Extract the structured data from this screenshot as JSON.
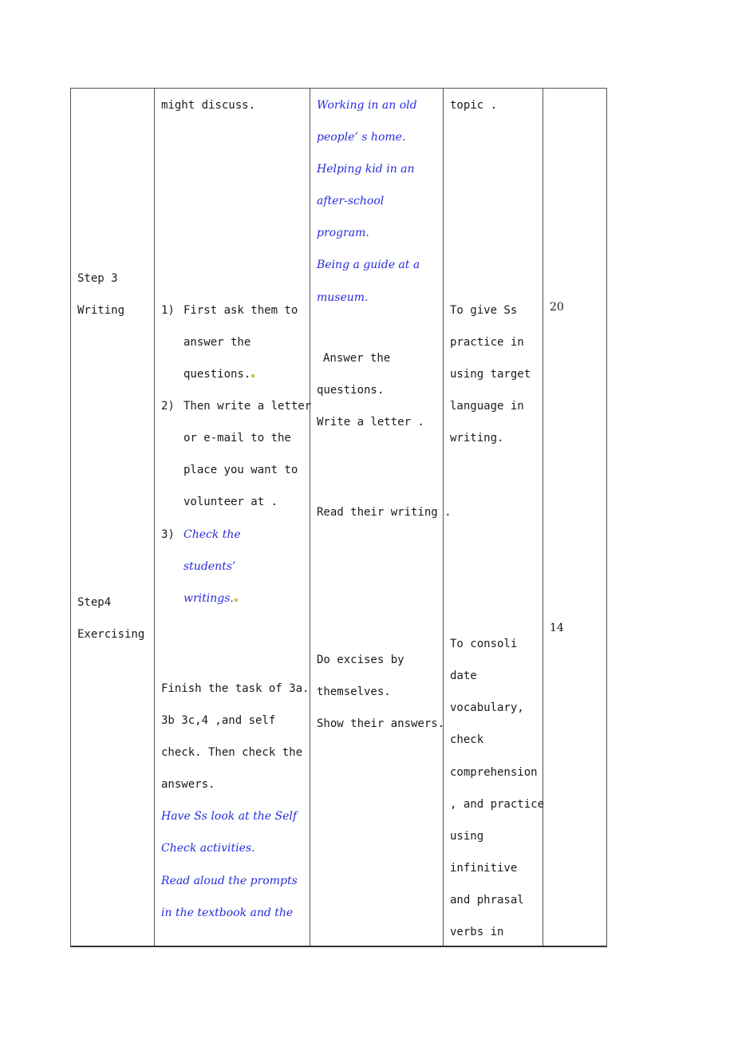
{
  "table": {
    "step_column": [
      {
        "id": "step3",
        "lines": [
          "Step 3",
          "Writing"
        ]
      },
      {
        "id": "step4",
        "lines": [
          "Step4",
          "Exercising"
        ]
      }
    ],
    "teacher_activities": {
      "intro_tail": "might discuss.",
      "writing_items": [
        {
          "num": "1)",
          "lines": [
            "First ask them to",
            "answer the",
            "questions."
          ]
        },
        {
          "num": "2)",
          "lines": [
            "Then write a letter",
            "or e-mail to the",
            "place you want to",
            "volunteer at ."
          ]
        },
        {
          "num": "3)",
          "lines": [
            "Check the",
            "students’",
            "writings."
          ]
        }
      ],
      "exercise_lines": [
        "Finish the task of 3a.",
        "3b  3c,4  ,and self",
        "check. Then check the",
        "answers."
      ],
      "exercise_blue_lines": [
        "Have Ss look at the Self",
        "Check activities.",
        "Read aloud the prompts",
        "in the textbook and the"
      ]
    },
    "student_activities": {
      "options_blue": [
        "Working in an old",
        "people’ s home.",
        "Helping kid in an",
        "after-school",
        "program.",
        "Being a guide at a",
        "museum."
      ],
      "writing_lines": [
        "Answer the",
        "questions.",
        "Write a letter ."
      ],
      "read_line": "Read their writing .",
      "exercise_lines": [
        "Do excises by",
        "themselves.",
        "Show their answers."
      ]
    },
    "purpose": {
      "intro_tail": "topic .",
      "writing_lines": [
        "To give Ss",
        "practice in",
        "using target",
        "language in",
        "writing."
      ],
      "exercise_lines": [
        "To consoli",
        "date",
        "vocabulary,",
        "check",
        "comprehension",
        ", and practice",
        "using",
        "infinitive",
        "and phrasal",
        "verbs in"
      ]
    },
    "time": {
      "writing": "20",
      "exercising": "14"
    }
  }
}
